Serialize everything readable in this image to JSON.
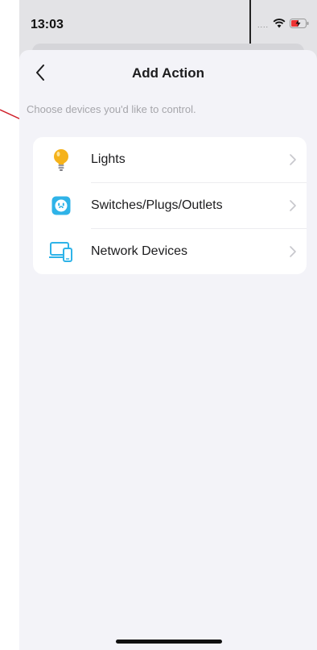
{
  "status_bar": {
    "time": "13:03",
    "signal": "....",
    "wifi_icon": "wifi-icon",
    "battery_icon": "battery-charging-icon"
  },
  "nav": {
    "back_icon": "chevron-left-icon",
    "title": "Add Action"
  },
  "subtitle": "Choose devices you'd like to control.",
  "devices": [
    {
      "label": "Lights",
      "icon": "lightbulb-icon"
    },
    {
      "label": "Switches/Plugs/Outlets",
      "icon": "smart-plug-icon"
    },
    {
      "label": "Network Devices",
      "icon": "network-devices-icon"
    }
  ],
  "colors": {
    "background": "#f3f3f8",
    "card": "#ffffff",
    "accent_blue": "#2fb3e8",
    "bulb_yellow": "#f5b21b",
    "annotation_red": "#d0202a"
  }
}
